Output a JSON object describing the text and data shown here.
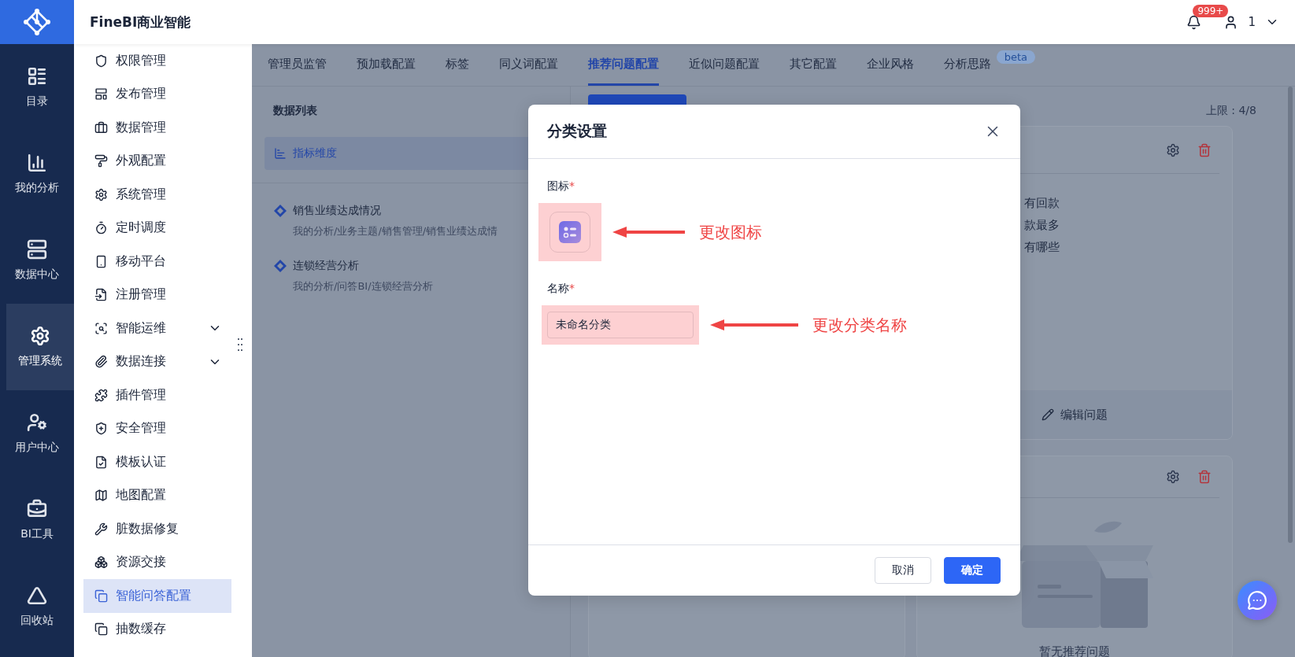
{
  "app": {
    "title": "FineBI商业智能"
  },
  "rail": [
    {
      "label": "目录",
      "selected": false
    },
    {
      "label": "我的分析",
      "selected": false
    },
    {
      "label": "数据中心",
      "selected": false
    },
    {
      "label": "管理系统",
      "selected": true
    },
    {
      "label": "用户中心",
      "selected": false
    },
    {
      "label": "BI工具",
      "selected": false
    },
    {
      "label": "回收站",
      "selected": false
    }
  ],
  "header": {
    "notification_badge": "999+",
    "user": "1"
  },
  "menu": [
    {
      "label": "权限管理",
      "kind": "page",
      "selected": false
    },
    {
      "label": "发布管理",
      "kind": "page",
      "selected": false
    },
    {
      "label": "数据管理",
      "kind": "page",
      "selected": false
    },
    {
      "label": "外观配置",
      "kind": "page",
      "selected": false
    },
    {
      "label": "系统管理",
      "kind": "page",
      "selected": false
    },
    {
      "label": "定时调度",
      "kind": "page",
      "selected": false
    },
    {
      "label": "移动平台",
      "kind": "page",
      "selected": false
    },
    {
      "label": "注册管理",
      "kind": "page",
      "selected": false
    },
    {
      "label": "智能运维",
      "kind": "group",
      "expanded": false,
      "selected": false
    },
    {
      "label": "数据连接",
      "kind": "group",
      "expanded": false,
      "selected": false
    },
    {
      "label": "插件管理",
      "kind": "page",
      "selected": false
    },
    {
      "label": "安全管理",
      "kind": "page",
      "selected": false
    },
    {
      "label": "模板认证",
      "kind": "page",
      "selected": false
    },
    {
      "label": "地图配置",
      "kind": "page",
      "selected": false
    },
    {
      "label": "脏数据修复",
      "kind": "page",
      "selected": false
    },
    {
      "label": "资源交接",
      "kind": "page",
      "selected": false
    },
    {
      "label": "智能问答配置",
      "kind": "page",
      "selected": true
    },
    {
      "label": "抽数缓存",
      "kind": "page",
      "selected": false
    }
  ],
  "tabs": [
    {
      "label": "管理员监管",
      "selected": false
    },
    {
      "label": "预加载配置",
      "selected": false
    },
    {
      "label": "标签",
      "selected": false
    },
    {
      "label": "同义词配置",
      "selected": false
    },
    {
      "label": "推荐问题配置",
      "selected": true
    },
    {
      "label": "近似问题配置",
      "selected": false
    },
    {
      "label": "其它配置",
      "selected": false
    },
    {
      "label": "企业风格",
      "selected": false
    },
    {
      "label": "分析思路",
      "selected": false,
      "badge": "beta"
    }
  ],
  "data_list": {
    "title": "数据列表",
    "tabs": [
      {
        "label": "指标维度",
        "selected": true
      }
    ],
    "items": [
      {
        "title": "销售业绩达成情况",
        "path": "我的分析/业务主题/销售管理/销售业绩达成情"
      },
      {
        "title": "连锁经营分析",
        "path": "我的分析/问答BI/连锁经营分析"
      }
    ]
  },
  "limit": "上限 : 4/8",
  "cards": [
    {
      "kind": "questions",
      "questions": [
        "有回款",
        "款最多",
        "有哪些"
      ],
      "footer": "编辑问题"
    },
    {
      "kind": "empty",
      "empty_text": "暂无推荐问题"
    }
  ],
  "dialog": {
    "title": "分类设置",
    "fields": [
      {
        "kind": "icon",
        "label": "图标",
        "required_mark": "*",
        "annotation": "更改图标"
      },
      {
        "kind": "text",
        "label": "名称",
        "required_mark": "*",
        "value": "未命名分类",
        "annotation": "更改分类名称"
      }
    ],
    "buttons": [
      {
        "label": "取消",
        "kind": "secondary"
      },
      {
        "label": "确定",
        "kind": "primary"
      }
    ]
  }
}
